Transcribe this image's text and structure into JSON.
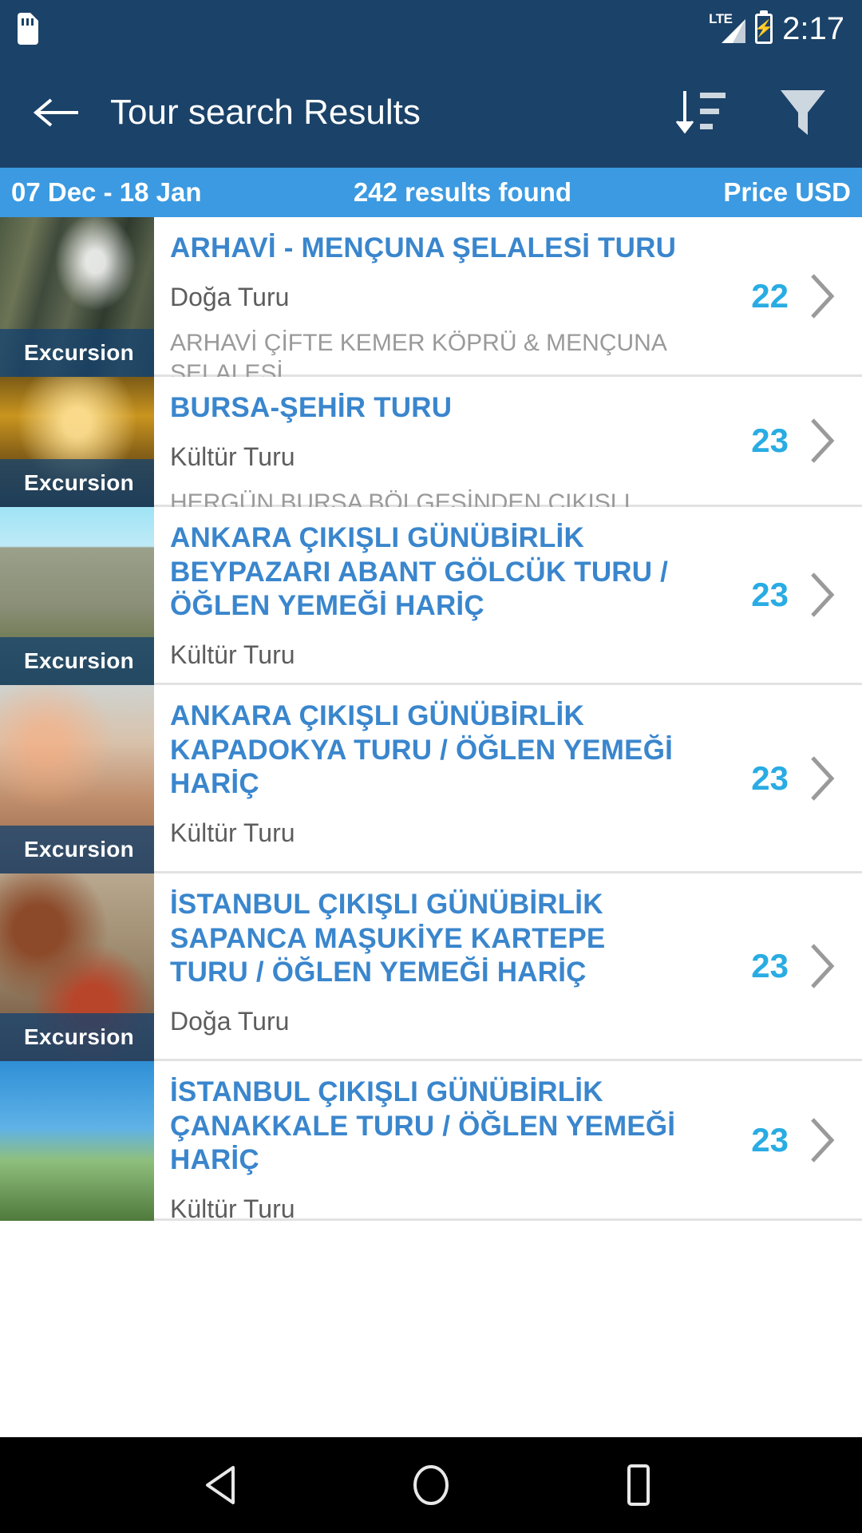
{
  "status_bar": {
    "sdcard_icon": "sd-card-icon",
    "network_label": "LTE",
    "signal_icon": "signal-bars-icon",
    "battery_icon": "battery-charging-icon",
    "time": "2:17"
  },
  "app_bar": {
    "back_icon": "back-arrow-icon",
    "title": "Tour search Results",
    "sort_icon": "sort-descending-icon",
    "filter_icon": "filter-funnel-icon"
  },
  "sub_header": {
    "dates": "07 Dec - 18 Jan",
    "results": "242 results found",
    "price_label": "Price USD",
    "background": "#3b9ae1"
  },
  "colors": {
    "app_bar": "#1b4268",
    "sub_header": "#3b9ae1",
    "title_blue": "#3a86cd",
    "price_cyan": "#29ace3",
    "category_gray": "#5d5d5d",
    "description_gray": "#9a9a9a",
    "badge_overlay": "#16426e"
  },
  "results": [
    {
      "title": "ARHAVİ - MENÇUNA ŞELALESİ TURU",
      "category": "Doğa Turu",
      "description": "ARHAVİ ÇİFTE KEMER KÖPRÜ & MENÇUNA ŞELALESİ",
      "badge": "Excursion",
      "price": "22",
      "thumb": "waterfall-photo",
      "chevron_icon": "chevron-right-icon"
    },
    {
      "title": "BURSA-ŞEHİR TURU",
      "category": "Kültür Turu",
      "description": "HERGÜN BURSA BÖLGESİNDEN ÇIKIŞLI",
      "badge": "Excursion",
      "price": "23",
      "thumb": "bursa-mosque-photo",
      "chevron_icon": "chevron-right-icon"
    },
    {
      "title": "ANKARA ÇIKIŞLI GÜNÜBİRLİK BEYPAZARI ABANT GÖLCÜK TURU / ÖĞLEN YEMEĞİ HARİÇ",
      "category": "Kültür Turu",
      "description": "",
      "badge": "Excursion",
      "price": "23",
      "thumb": "beypazari-cliffs-photo",
      "chevron_icon": "chevron-right-icon"
    },
    {
      "title": "ANKARA ÇIKIŞLI GÜNÜBİRLİK KAPADOKYA TURU / ÖĞLEN YEMEĞİ HARİÇ",
      "category": "Kültür Turu",
      "description": "",
      "badge": "Excursion",
      "price": "23",
      "thumb": "kapadokya-balloons-photo",
      "chevron_icon": "chevron-right-icon"
    },
    {
      "title": "İSTANBUL ÇIKIŞLI GÜNÜBİRLİK SAPANCA MAŞUKİYE KARTEPE TURU / ÖĞLEN YEMEĞİ HARİÇ",
      "category": "Doğa Turu",
      "description": "",
      "badge": "Excursion",
      "price": "23",
      "thumb": "turkish-food-photo",
      "chevron_icon": "chevron-right-icon"
    },
    {
      "title": "İSTANBUL ÇIKIŞLI GÜNÜBİRLİK ÇANAKKALE TURU / ÖĞLEN YEMEĞİ HARİÇ",
      "category": "Kültür Turu",
      "description": "",
      "badge": "",
      "price": "23",
      "thumb": "canakkale-monument-photo",
      "chevron_icon": "chevron-right-icon"
    }
  ],
  "nav_bar": {
    "back_icon": "nav-back-triangle-icon",
    "home_icon": "nav-home-circle-icon",
    "recents_icon": "nav-recents-square-icon"
  }
}
